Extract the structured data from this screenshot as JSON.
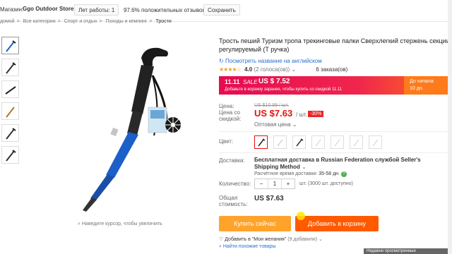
{
  "store": {
    "label": "Магазин:",
    "name": "Ggo Outdoor Store",
    "hours": "Лет работы: 1",
    "hours_suffix": "",
    "feedback_pct": "97.6%",
    "feedback_label": "положительных отзывов",
    "save_label": "Сохранить"
  },
  "breadcrumb": [
    "домой",
    "Все категории",
    "Спорт и отдых",
    "Походы и кемпинг",
    "Трости"
  ],
  "zoom_hint": "Наведите курсор, чтобы увеличить",
  "product": {
    "title": "Трость пеший Туризм тропа трекинговые палки Сверхлегкий стержень секции регулируемый (T ручка)",
    "translate_link": "Посмотреть название на английском",
    "rating": "4.0",
    "votes": "(2 голоса(ов))",
    "orders": "6 заказа(ов)"
  },
  "sale": {
    "tag": "11.11",
    "word": "SALE",
    "price": "US $ 7.52",
    "note": "Добавьте в корзину заранее, чтобы купить со скидкой 11.11",
    "start_label": "До начала",
    "start_value": "10 дн."
  },
  "price": {
    "label": "Цена:",
    "old": "US $10.99 / шт.",
    "discount_label": "Цена со скидкой:",
    "new": "US $7.63",
    "unit": "/ шт.",
    "discount": "-30%",
    "bulk": "Оптовая цена"
  },
  "color": {
    "label": "Цвет:"
  },
  "shipping": {
    "label": "Доставка:",
    "text": "Бесплатная доставка в Russian Federation службой Seller's Shipping Method",
    "eta_label": "Расчётное время доставки:",
    "eta_value": "35-58 дн."
  },
  "quantity": {
    "label": "Количество:",
    "minus": "−",
    "value": "1",
    "plus": "+",
    "stock": "шт. (3000 шт. доступно)"
  },
  "total": {
    "label": "Общая стоимость:",
    "value": "US $7.63"
  },
  "actions": {
    "buy_now": "Купить сейчас",
    "add_to_cart": "Добавить в корзину",
    "wishlist": "Добавить в \"Мои желания\"",
    "wishlist_count": "(9 добавили)",
    "similar": "Найти похожие товары"
  },
  "recent": "Недавно просмотренные",
  "colors": {
    "accent_red": "#e6100c",
    "buy_orange": "#ffa32b",
    "cart_orange": "#ff5a00",
    "link_blue": "#2a6fd1",
    "pole_blue": "#1d5fc9"
  }
}
